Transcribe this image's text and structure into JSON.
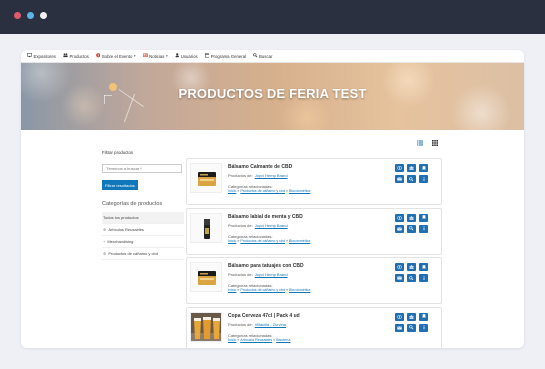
{
  "colors": {
    "topbar": "#2b3040",
    "dot_red": "#e05a6b",
    "dot_blue": "#5bb5ea",
    "dot_white": "#f3f3f5",
    "accent": "#1177bb"
  },
  "nav": {
    "items": [
      {
        "icon": "monitor-icon",
        "label": "Expositores",
        "dropdown": false
      },
      {
        "icon": "users-icon",
        "label": "Productos",
        "dropdown": false
      },
      {
        "icon": "info-circle-icon",
        "label": "Sobre el Evento",
        "dropdown": true
      },
      {
        "icon": "newspaper-icon",
        "label": "Noticias",
        "dropdown": true
      },
      {
        "icon": "user-icon",
        "label": "Usuarios",
        "dropdown": false
      },
      {
        "icon": "calendar-icon",
        "label": "Programa General",
        "dropdown": false
      },
      {
        "icon": "search-icon",
        "label": "Buscar",
        "dropdown": false
      }
    ]
  },
  "hero": {
    "title": "PRODUCTOS DE FERIA TEST"
  },
  "sidebar": {
    "filter_label": "Filtrar productos",
    "search_placeholder": "Términos a buscar *",
    "filter_button": "Filtrar resultados",
    "categories_title": "Categorías de productos",
    "categories": [
      {
        "label": "Todos los productos",
        "active": true,
        "prefix": ""
      },
      {
        "label": "Artículos Reusables",
        "active": false,
        "prefix": "⊕"
      },
      {
        "label": "Merchandising",
        "active": false,
        "prefix": "+"
      },
      {
        "label": "Productos de cáñamo y cbd",
        "active": false,
        "prefix": "⊕"
      }
    ]
  },
  "view": {
    "list_icon": "list-view-icon",
    "grid_icon": "grid-view-icon"
  },
  "products": [
    {
      "title": "Bálsamo Calmante de CBD",
      "producer_prefix": "Productos de:",
      "producer": "Joyví Hemp Brand",
      "categories_label": "Categorías relacionadas:",
      "categories": [
        "Inicio",
        "Productos de cáñamo y cbd",
        "Biocosmética"
      ],
      "thumb": "balm-jar"
    },
    {
      "title": "Bálsamo labial de menta y CBD",
      "producer_prefix": "Productos de:",
      "producer": "Joyví Hemp Brand",
      "categories_label": "Categorías relacionadas:",
      "categories": [
        "Inicio",
        "Productos de cáñamo y cbd",
        "Biocosmética"
      ],
      "thumb": "lip-balm"
    },
    {
      "title": "Bálsamo para tatuajes con CBD",
      "producer_prefix": "Productos de:",
      "producer": "Joyví Hemp Brand",
      "categories_label": "Categorías relacionadas:",
      "categories": [
        "Inicio",
        "Productos de cáñamo y cbd",
        "Biocosmética"
      ],
      "thumb": "balm-jar"
    },
    {
      "title": "Copa Cerveza 47cl | Pack 4 ud",
      "producer_prefix": "Productos de:",
      "producer": "Villacilla - Zurvina",
      "categories_label": "Categorías relacionadas:",
      "categories": [
        "Inicio",
        "Artículos Reusables",
        "Bisutería"
      ],
      "thumb": "beer-glasses"
    }
  ],
  "action_icons": [
    "eye-icon",
    "people-icon",
    "bookmark-icon",
    "mail-icon",
    "search-icon",
    "info-icon"
  ]
}
